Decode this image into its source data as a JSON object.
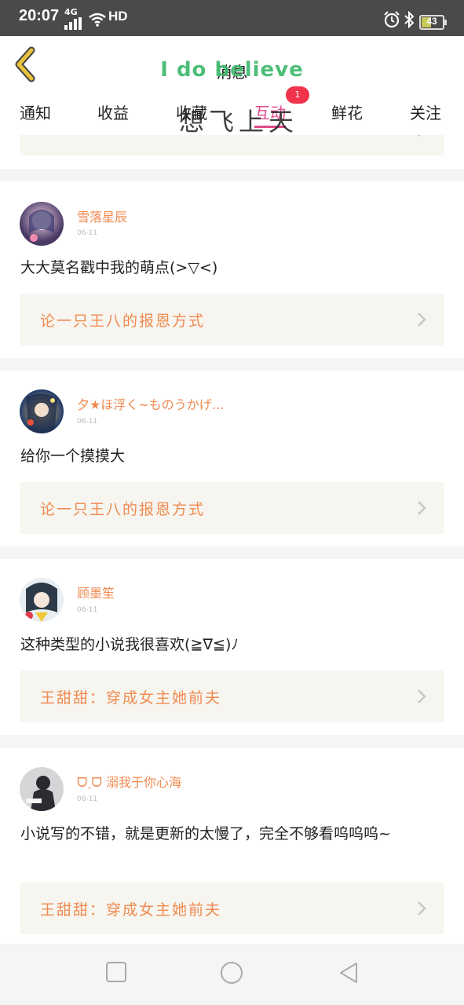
{
  "status": {
    "time": "20:07",
    "network": "4G",
    "hd": "HD",
    "battery": "43"
  },
  "header": {
    "title": "消息",
    "overlay": "I do believe",
    "overlay2": "想飞上天"
  },
  "tabs": [
    {
      "label": "通知"
    },
    {
      "label": "收益"
    },
    {
      "label": "收藏"
    },
    {
      "label": "互动",
      "active": true
    },
    {
      "label": "鲜花"
    },
    {
      "label": "关注"
    }
  ],
  "badge": "1",
  "comments": [
    {
      "user": "雪落星辰",
      "date": "06-11",
      "text": "大大莫名戳中我的萌点(>▽<)",
      "link": "论一只王八的报恩方式"
    },
    {
      "user": "夕★ほ浮く~ものうかげ…",
      "date": "06-11",
      "text": "给你一个摸摸大",
      "link": "论一只王八的报恩方式"
    },
    {
      "user": "顾墨笙",
      "date": "06-11",
      "text": "这种类型的小说我很喜欢(≧∇≦)ﾉ",
      "link": "王甜甜：穿成女主她前夫"
    },
    {
      "user": "ᗜ˰ᗜ 溺我于你心海",
      "date": "06-11",
      "text": "小说写的不错，就是更新的太慢了，完全不够看呜呜呜~",
      "link": "王甜甜：穿成女主她前夫"
    }
  ],
  "colors": {
    "accent": "#f08a50",
    "tab_active": "#e04b8a",
    "badge": "#f0324a",
    "back": "#e8c23a"
  }
}
